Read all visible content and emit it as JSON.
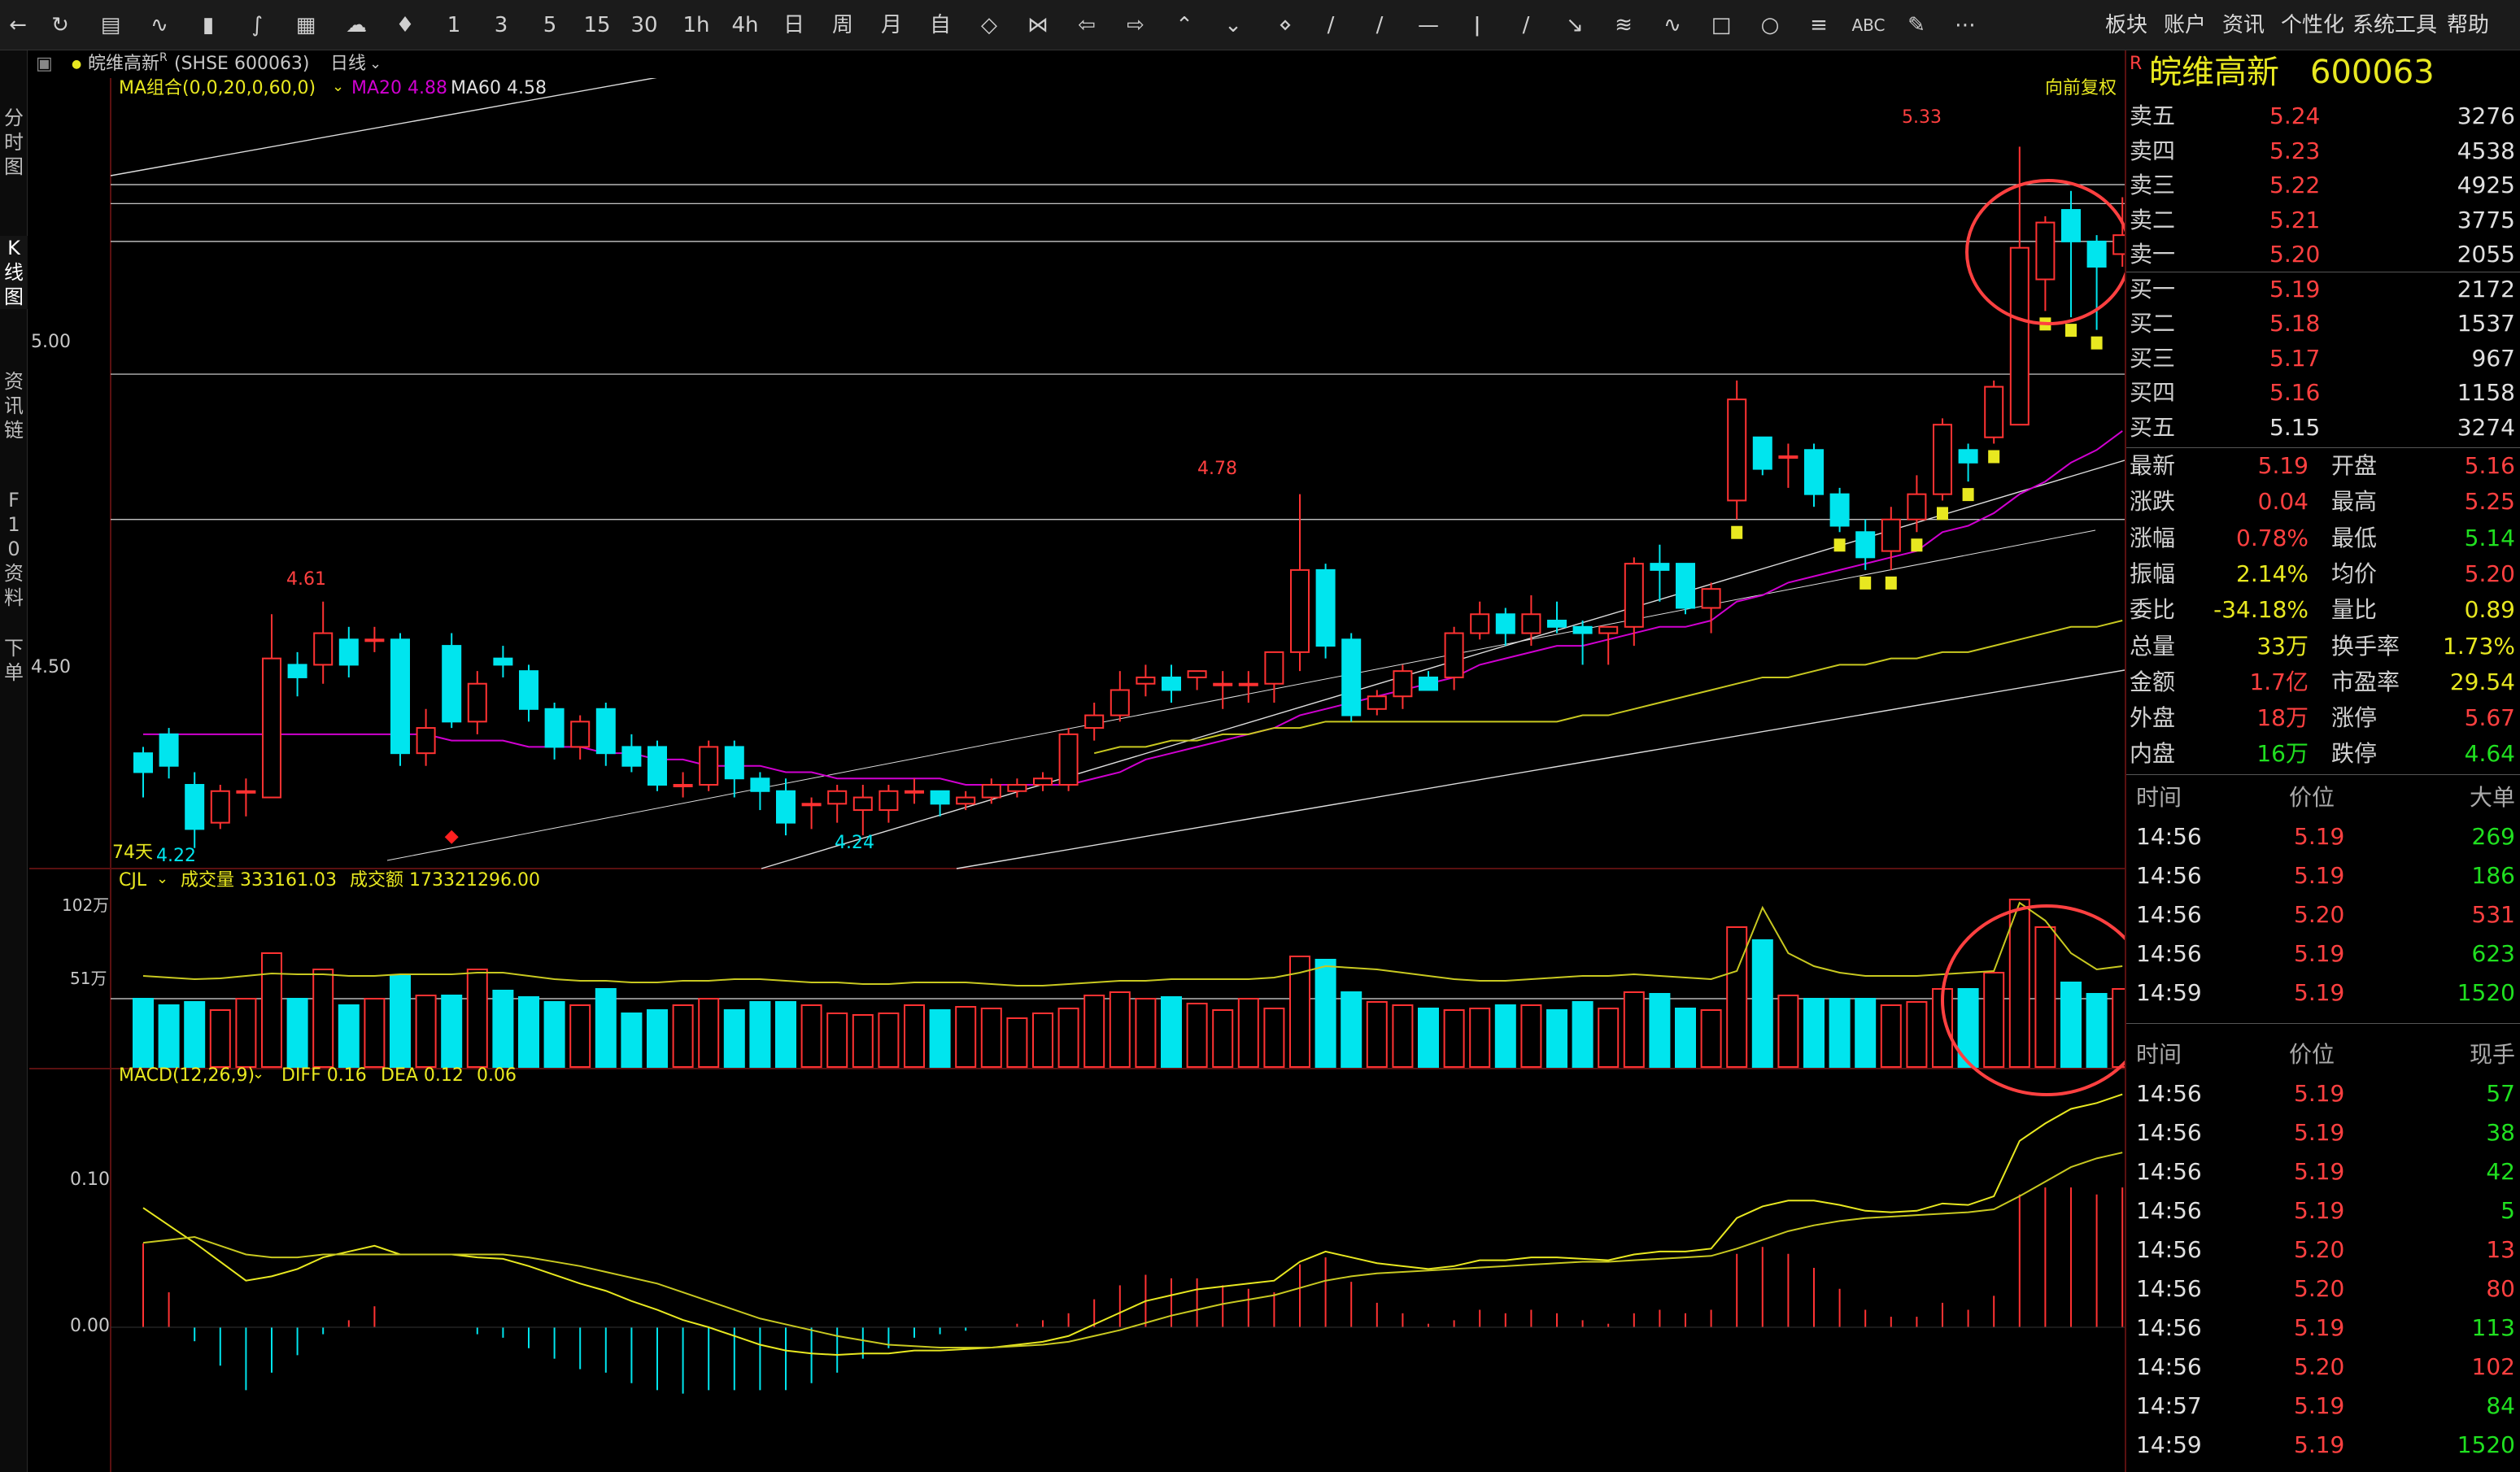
{
  "toolbar": {
    "periods": [
      "1",
      "3",
      "5",
      "15",
      "30",
      "1h",
      "4h",
      "日",
      "周",
      "月",
      "自"
    ],
    "tool_abc": "ABC",
    "menu": [
      "板块",
      "账户",
      "资讯",
      "个性化",
      "系统工具",
      "帮助"
    ]
  },
  "sidetabs": [
    {
      "label": "分时图",
      "active": false
    },
    {
      "label": "K线图",
      "active": true
    },
    {
      "label": "资讯链",
      "active": false
    },
    {
      "label": "F10资料",
      "active": false
    },
    {
      "label": "下单",
      "active": false
    }
  ],
  "infobar": {
    "name": "皖维高新",
    "super": "R",
    "code": "(SHSE 600063)",
    "period": "日线"
  },
  "chart": {
    "ma_label": "MA组合(0,0,20,0,60,0)",
    "ma20_label": "MA20 4.88",
    "ma60_label": "MA60 4.58",
    "restore": "向前复权",
    "price_ticks": [
      "5.00",
      "4.50"
    ],
    "annotations": {
      "high": "5.33",
      "peak1": "4.78",
      "peak0": "4.61",
      "low1": "4.22",
      "low2": "4.24",
      "days": "74天"
    },
    "vol_label": "CJL",
    "vol_text": "成交量 333161.03",
    "amt_text": "成交额 173321296.00",
    "vol_ticks": [
      "102万",
      "51万"
    ],
    "macd_label": "MACD(12,26,9)",
    "diff_text": "DIFF 0.16",
    "dea_text": "DEA 0.12",
    "macd_val": "0.06",
    "macd_ticks": [
      "0.10",
      "0.00"
    ],
    "colors": {
      "up": "#ff3232",
      "down": "#00e5ee",
      "ma20": "#d000d0",
      "ma60": "#c8c820",
      "line": "#dddddd",
      "circle": "#ff4040"
    },
    "candles": [
      {
        "o": 4.37,
        "c": 4.34,
        "h": 4.38,
        "l": 4.3
      },
      {
        "o": 4.4,
        "c": 4.35,
        "h": 4.41,
        "l": 4.33
      },
      {
        "o": 4.32,
        "c": 4.25,
        "h": 4.34,
        "l": 4.22
      },
      {
        "o": 4.26,
        "c": 4.31,
        "h": 4.32,
        "l": 4.25
      },
      {
        "o": 4.31,
        "c": 4.31,
        "h": 4.33,
        "l": 4.27
      },
      {
        "o": 4.3,
        "c": 4.52,
        "h": 4.59,
        "l": 4.3
      },
      {
        "o": 4.51,
        "c": 4.49,
        "h": 4.53,
        "l": 4.46
      },
      {
        "o": 4.51,
        "c": 4.56,
        "h": 4.61,
        "l": 4.48
      },
      {
        "o": 4.55,
        "c": 4.51,
        "h": 4.57,
        "l": 4.49
      },
      {
        "o": 4.55,
        "c": 4.55,
        "h": 4.57,
        "l": 4.53
      },
      {
        "o": 4.55,
        "c": 4.37,
        "h": 4.56,
        "l": 4.35
      },
      {
        "o": 4.37,
        "c": 4.41,
        "h": 4.44,
        "l": 4.35
      },
      {
        "o": 4.54,
        "c": 4.42,
        "h": 4.56,
        "l": 4.41
      },
      {
        "o": 4.42,
        "c": 4.48,
        "h": 4.5,
        "l": 4.4
      },
      {
        "o": 4.52,
        "c": 4.51,
        "h": 4.54,
        "l": 4.49
      },
      {
        "o": 4.5,
        "c": 4.44,
        "h": 4.51,
        "l": 4.42
      },
      {
        "o": 4.44,
        "c": 4.38,
        "h": 4.45,
        "l": 4.36
      },
      {
        "o": 4.38,
        "c": 4.42,
        "h": 4.43,
        "l": 4.36
      },
      {
        "o": 4.44,
        "c": 4.37,
        "h": 4.45,
        "l": 4.35
      },
      {
        "o": 4.38,
        "c": 4.35,
        "h": 4.4,
        "l": 4.34
      },
      {
        "o": 4.38,
        "c": 4.32,
        "h": 4.39,
        "l": 4.31
      },
      {
        "o": 4.32,
        "c": 4.32,
        "h": 4.34,
        "l": 4.3
      },
      {
        "o": 4.32,
        "c": 4.38,
        "h": 4.39,
        "l": 4.31
      },
      {
        "o": 4.38,
        "c": 4.33,
        "h": 4.39,
        "l": 4.3
      },
      {
        "o": 4.33,
        "c": 4.31,
        "h": 4.34,
        "l": 4.28
      },
      {
        "o": 4.31,
        "c": 4.26,
        "h": 4.33,
        "l": 4.24
      },
      {
        "o": 4.29,
        "c": 4.29,
        "h": 4.3,
        "l": 4.25
      },
      {
        "o": 4.29,
        "c": 4.31,
        "h": 4.32,
        "l": 4.26
      },
      {
        "o": 4.28,
        "c": 4.3,
        "h": 4.32,
        "l": 4.24
      },
      {
        "o": 4.28,
        "c": 4.31,
        "h": 4.32,
        "l": 4.26
      },
      {
        "o": 4.31,
        "c": 4.31,
        "h": 4.33,
        "l": 4.29
      },
      {
        "o": 4.31,
        "c": 4.29,
        "h": 4.31,
        "l": 4.27
      },
      {
        "o": 4.29,
        "c": 4.3,
        "h": 4.31,
        "l": 4.28
      },
      {
        "o": 4.3,
        "c": 4.32,
        "h": 4.33,
        "l": 4.29
      },
      {
        "o": 4.31,
        "c": 4.32,
        "h": 4.33,
        "l": 4.3
      },
      {
        "o": 4.32,
        "c": 4.33,
        "h": 4.34,
        "l": 4.31
      },
      {
        "o": 4.32,
        "c": 4.4,
        "h": 4.41,
        "l": 4.31
      },
      {
        "o": 4.41,
        "c": 4.43,
        "h": 4.45,
        "l": 4.39
      },
      {
        "o": 4.43,
        "c": 4.47,
        "h": 4.5,
        "l": 4.42
      },
      {
        "o": 4.48,
        "c": 4.49,
        "h": 4.51,
        "l": 4.46
      },
      {
        "o": 4.49,
        "c": 4.47,
        "h": 4.51,
        "l": 4.45
      },
      {
        "o": 4.49,
        "c": 4.5,
        "h": 4.5,
        "l": 4.47
      },
      {
        "o": 4.48,
        "c": 4.48,
        "h": 4.5,
        "l": 4.44
      },
      {
        "o": 4.48,
        "c": 4.48,
        "h": 4.5,
        "l": 4.45
      },
      {
        "o": 4.48,
        "c": 4.53,
        "h": 4.53,
        "l": 4.45
      },
      {
        "o": 4.53,
        "c": 4.66,
        "h": 4.78,
        "l": 4.5
      },
      {
        "o": 4.66,
        "c": 4.54,
        "h": 4.67,
        "l": 4.52
      },
      {
        "o": 4.55,
        "c": 4.43,
        "h": 4.56,
        "l": 4.42
      },
      {
        "o": 4.44,
        "c": 4.46,
        "h": 4.47,
        "l": 4.43
      },
      {
        "o": 4.46,
        "c": 4.5,
        "h": 4.51,
        "l": 4.44
      },
      {
        "o": 4.49,
        "c": 4.47,
        "h": 4.5,
        "l": 4.47
      },
      {
        "o": 4.49,
        "c": 4.56,
        "h": 4.57,
        "l": 4.47
      },
      {
        "o": 4.56,
        "c": 4.59,
        "h": 4.61,
        "l": 4.55
      },
      {
        "o": 4.59,
        "c": 4.56,
        "h": 4.6,
        "l": 4.54
      },
      {
        "o": 4.56,
        "c": 4.59,
        "h": 4.62,
        "l": 4.54
      },
      {
        "o": 4.58,
        "c": 4.57,
        "h": 4.61,
        "l": 4.56
      },
      {
        "o": 4.57,
        "c": 4.56,
        "h": 4.58,
        "l": 4.51
      },
      {
        "o": 4.56,
        "c": 4.57,
        "h": 4.57,
        "l": 4.51
      },
      {
        "o": 4.57,
        "c": 4.67,
        "h": 4.68,
        "l": 4.54
      },
      {
        "o": 4.67,
        "c": 4.66,
        "h": 4.7,
        "l": 4.61
      },
      {
        "o": 4.67,
        "c": 4.6,
        "h": 4.67,
        "l": 4.59
      },
      {
        "o": 4.6,
        "c": 4.63,
        "h": 4.64,
        "l": 4.56
      },
      {
        "o": 4.77,
        "c": 4.93,
        "h": 4.96,
        "l": 4.74
      },
      {
        "o": 4.87,
        "c": 4.82,
        "h": 4.87,
        "l": 4.81
      },
      {
        "o": 4.84,
        "c": 4.84,
        "h": 4.86,
        "l": 4.79
      },
      {
        "o": 4.85,
        "c": 4.78,
        "h": 4.86,
        "l": 4.76
      },
      {
        "o": 4.78,
        "c": 4.73,
        "h": 4.79,
        "l": 4.72
      },
      {
        "o": 4.72,
        "c": 4.68,
        "h": 4.74,
        "l": 4.66
      },
      {
        "o": 4.69,
        "c": 4.74,
        "h": 4.76,
        "l": 4.66
      },
      {
        "o": 4.74,
        "c": 4.78,
        "h": 4.81,
        "l": 4.72
      },
      {
        "o": 4.78,
        "c": 4.89,
        "h": 4.9,
        "l": 4.77
      },
      {
        "o": 4.85,
        "c": 4.83,
        "h": 4.86,
        "l": 4.8
      },
      {
        "o": 4.87,
        "c": 4.95,
        "h": 4.96,
        "l": 4.86
      },
      {
        "o": 4.89,
        "c": 5.17,
        "h": 5.33,
        "l": 4.89
      },
      {
        "o": 5.12,
        "c": 5.21,
        "h": 5.22,
        "l": 5.07
      },
      {
        "o": 5.23,
        "c": 5.18,
        "h": 5.26,
        "l": 5.06
      },
      {
        "o": 5.18,
        "c": 5.14,
        "h": 5.19,
        "l": 5.04
      },
      {
        "o": 5.16,
        "c": 5.19,
        "h": 5.25,
        "l": 5.14
      }
    ],
    "volumes": [
      420000,
      380000,
      400000,
      350000,
      420000,
      700000,
      420000,
      600000,
      380000,
      420000,
      560000,
      440000,
      440000,
      600000,
      470000,
      430000,
      400000,
      380000,
      480000,
      330000,
      350000,
      380000,
      420000,
      350000,
      400000,
      400000,
      380000,
      330000,
      320000,
      330000,
      380000,
      350000,
      370000,
      360000,
      300000,
      330000,
      360000,
      440000,
      460000,
      420000,
      430000,
      390000,
      350000,
      420000,
      360000,
      680000,
      660000,
      460000,
      400000,
      380000,
      360000,
      350000,
      360000,
      380000,
      380000,
      350000,
      400000,
      360000,
      460000,
      450000,
      360000,
      350000,
      860000,
      780000,
      440000,
      420000,
      420000,
      420000,
      380000,
      400000,
      480000,
      480000,
      580000,
      1030000,
      860000,
      520000,
      450000,
      480000
    ],
    "vol_ma": [
      560000,
      550000,
      540000,
      545000,
      560000,
      575000,
      570000,
      570000,
      560000,
      560000,
      570000,
      570000,
      570000,
      580000,
      580000,
      560000,
      540000,
      530000,
      530000,
      520000,
      520000,
      530000,
      530000,
      540000,
      540000,
      530000,
      520000,
      520000,
      510000,
      510000,
      520000,
      520000,
      520000,
      510000,
      500000,
      500000,
      510000,
      520000,
      530000,
      530000,
      540000,
      540000,
      540000,
      540000,
      550000,
      580000,
      620000,
      610000,
      600000,
      580000,
      560000,
      540000,
      530000,
      530000,
      540000,
      550000,
      560000,
      560000,
      570000,
      560000,
      550000,
      540000,
      590000,
      980000,
      700000,
      620000,
      580000,
      560000,
      560000,
      560000,
      570000,
      580000,
      590000,
      1010000,
      900000,
      700000,
      600000,
      620000
    ],
    "diff": [
      0.082,
      0.07,
      0.058,
      0.045,
      0.032,
      0.035,
      0.04,
      0.048,
      0.052,
      0.056,
      0.05,
      0.05,
      0.05,
      0.048,
      0.047,
      0.042,
      0.036,
      0.03,
      0.025,
      0.018,
      0.012,
      0.005,
      0.0,
      -0.006,
      -0.012,
      -0.016,
      -0.018,
      -0.019,
      -0.018,
      -0.018,
      -0.016,
      -0.016,
      -0.015,
      -0.014,
      -0.012,
      -0.01,
      -0.006,
      0.002,
      0.01,
      0.018,
      0.022,
      0.026,
      0.028,
      0.03,
      0.032,
      0.045,
      0.052,
      0.048,
      0.044,
      0.042,
      0.04,
      0.042,
      0.046,
      0.046,
      0.048,
      0.048,
      0.047,
      0.046,
      0.05,
      0.052,
      0.052,
      0.054,
      0.075,
      0.083,
      0.087,
      0.087,
      0.084,
      0.08,
      0.079,
      0.08,
      0.085,
      0.084,
      0.09,
      0.128,
      0.14,
      0.15,
      0.154,
      0.16
    ],
    "dea": [
      0.058,
      0.06,
      0.062,
      0.056,
      0.05,
      0.048,
      0.048,
      0.05,
      0.05,
      0.05,
      0.05,
      0.05,
      0.05,
      0.05,
      0.05,
      0.048,
      0.045,
      0.042,
      0.038,
      0.034,
      0.03,
      0.024,
      0.018,
      0.012,
      0.006,
      0.002,
      -0.002,
      -0.006,
      -0.009,
      -0.012,
      -0.013,
      -0.014,
      -0.014,
      -0.014,
      -0.013,
      -0.012,
      -0.01,
      -0.006,
      -0.002,
      0.003,
      0.008,
      0.012,
      0.016,
      0.019,
      0.022,
      0.027,
      0.032,
      0.035,
      0.037,
      0.038,
      0.039,
      0.04,
      0.041,
      0.042,
      0.043,
      0.044,
      0.045,
      0.045,
      0.046,
      0.047,
      0.048,
      0.049,
      0.054,
      0.06,
      0.066,
      0.07,
      0.073,
      0.075,
      0.076,
      0.077,
      0.078,
      0.079,
      0.081,
      0.09,
      0.1,
      0.11,
      0.116,
      0.12
    ],
    "ma20": [
      4.4,
      4.4,
      4.4,
      4.4,
      4.4,
      4.4,
      4.4,
      4.4,
      4.4,
      4.4,
      4.4,
      4.4,
      4.39,
      4.39,
      4.39,
      4.38,
      4.38,
      4.38,
      4.37,
      4.37,
      4.36,
      4.36,
      4.35,
      4.35,
      4.35,
      4.34,
      4.34,
      4.33,
      4.33,
      4.33,
      4.33,
      4.33,
      4.32,
      4.32,
      4.32,
      4.32,
      4.32,
      4.33,
      4.34,
      4.36,
      4.37,
      4.38,
      4.39,
      4.4,
      4.41,
      4.43,
      4.44,
      4.45,
      4.46,
      4.47,
      4.48,
      4.49,
      4.51,
      4.52,
      4.53,
      4.54,
      4.54,
      4.55,
      4.56,
      4.57,
      4.57,
      4.58,
      4.61,
      4.62,
      4.64,
      4.65,
      4.66,
      4.67,
      4.68,
      4.69,
      4.72,
      4.73,
      4.75,
      4.78,
      4.8,
      4.83,
      4.85,
      4.88
    ],
    "ma60": [
      null,
      null,
      null,
      null,
      null,
      null,
      null,
      null,
      null,
      null,
      null,
      null,
      null,
      null,
      null,
      null,
      null,
      null,
      null,
      null,
      null,
      null,
      null,
      null,
      null,
      null,
      null,
      null,
      null,
      null,
      null,
      null,
      null,
      null,
      null,
      null,
      null,
      4.37,
      4.38,
      4.38,
      4.39,
      4.39,
      4.4,
      4.4,
      4.41,
      4.41,
      4.42,
      4.42,
      4.42,
      4.42,
      4.42,
      4.42,
      4.42,
      4.42,
      4.42,
      4.42,
      4.43,
      4.43,
      4.44,
      4.45,
      4.46,
      4.47,
      4.48,
      4.49,
      4.49,
      4.5,
      4.51,
      4.51,
      4.52,
      4.52,
      4.53,
      4.53,
      4.54,
      4.55,
      4.56,
      4.57,
      4.57,
      4.58
    ],
    "signal_idx": [
      62,
      66,
      67,
      68,
      69,
      70,
      71,
      72,
      74,
      75,
      76
    ]
  },
  "panel": {
    "title_R": "R",
    "title_name": "皖维高新",
    "title_code": "600063",
    "asks": [
      {
        "label": "卖五",
        "price": "5.24",
        "vol": "3276"
      },
      {
        "label": "卖四",
        "price": "5.23",
        "vol": "4538"
      },
      {
        "label": "卖三",
        "price": "5.22",
        "vol": "4925"
      },
      {
        "label": "卖二",
        "price": "5.21",
        "vol": "3775"
      },
      {
        "label": "卖一",
        "price": "5.20",
        "vol": "2055"
      }
    ],
    "bids": [
      {
        "label": "买一",
        "price": "5.19",
        "vol": "2172"
      },
      {
        "label": "买二",
        "price": "5.18",
        "vol": "1537"
      },
      {
        "label": "买三",
        "price": "5.17",
        "vol": "967"
      },
      {
        "label": "买四",
        "price": "5.16",
        "vol": "1158"
      },
      {
        "label": "买五",
        "price": "5.15",
        "vol": "3274"
      }
    ],
    "stats": [
      {
        "l1": "最新",
        "v1": "5.19",
        "c1": "red",
        "l2": "开盘",
        "v2": "5.16",
        "c2": "red"
      },
      {
        "l1": "涨跌",
        "v1": "0.04",
        "c1": "red",
        "l2": "最高",
        "v2": "5.25",
        "c2": "red"
      },
      {
        "l1": "涨幅",
        "v1": "0.78%",
        "c1": "red",
        "l2": "最低",
        "v2": "5.14",
        "c2": "green"
      },
      {
        "l1": "振幅",
        "v1": "2.14%",
        "c1": "yellow",
        "l2": "均价",
        "v2": "5.20",
        "c2": "red"
      },
      {
        "l1": "委比",
        "v1": "-34.18%",
        "c1": "yellow",
        "l2": "量比",
        "v2": "0.89",
        "c2": "yellow"
      },
      {
        "l1": "总量",
        "v1": "33万",
        "c1": "yellow",
        "l2": "换手率",
        "v2": "1.73%",
        "c2": "yellow"
      },
      {
        "l1": "金额",
        "v1": "1.7亿",
        "c1": "red",
        "l2": "市盈率",
        "v2": "29.54",
        "c2": "yellow"
      },
      {
        "l1": "外盘",
        "v1": "18万",
        "c1": "red",
        "l2": "涨停",
        "v2": "5.67",
        "c2": "red"
      },
      {
        "l1": "内盘",
        "v1": "16万",
        "c1": "green",
        "l2": "跌停",
        "v2": "4.64",
        "c2": "green"
      }
    ],
    "big_header": {
      "time": "时间",
      "price": "价位",
      "vol": "大单"
    },
    "big": [
      {
        "t": "14:56",
        "p": "5.19",
        "v": "269",
        "vc": "green"
      },
      {
        "t": "14:56",
        "p": "5.19",
        "v": "186",
        "vc": "green"
      },
      {
        "t": "14:56",
        "p": "5.20",
        "v": "531",
        "vc": "red"
      },
      {
        "t": "14:56",
        "p": "5.19",
        "v": "623",
        "vc": "green"
      },
      {
        "t": "14:59",
        "p": "5.19",
        "v": "1520",
        "vc": "green"
      }
    ],
    "tick_header": {
      "time": "时间",
      "price": "价位",
      "vol": "现手"
    },
    "ticks": [
      {
        "t": "14:56",
        "p": "5.19",
        "v": "57",
        "vc": "green"
      },
      {
        "t": "14:56",
        "p": "5.19",
        "v": "38",
        "vc": "green"
      },
      {
        "t": "14:56",
        "p": "5.19",
        "v": "42",
        "vc": "green"
      },
      {
        "t": "14:56",
        "p": "5.19",
        "v": "5",
        "vc": "green"
      },
      {
        "t": "14:56",
        "p": "5.20",
        "v": "13",
        "vc": "red"
      },
      {
        "t": "14:56",
        "p": "5.20",
        "v": "80",
        "vc": "red"
      },
      {
        "t": "14:56",
        "p": "5.19",
        "v": "113",
        "vc": "green"
      },
      {
        "t": "14:56",
        "p": "5.20",
        "v": "102",
        "vc": "red"
      },
      {
        "t": "14:57",
        "p": "5.19",
        "v": "84",
        "vc": "green"
      },
      {
        "t": "14:59",
        "p": "5.19",
        "v": "1520",
        "vc": "green"
      }
    ]
  }
}
